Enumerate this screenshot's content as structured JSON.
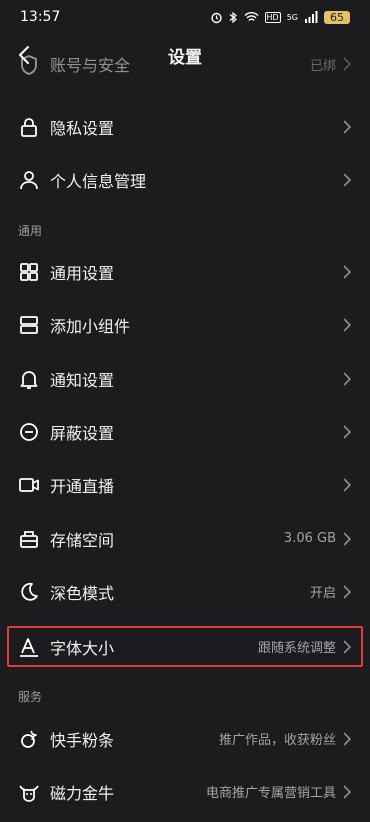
{
  "status": {
    "time": "13:57",
    "battery": "65",
    "network": "5G"
  },
  "nav": {
    "title": "设置"
  },
  "rows": [
    {
      "label": "账号与安全",
      "value": "已绑",
      "icon": "shield-icon"
    },
    {
      "label": "隐私设置",
      "value": "",
      "icon": "lock-icon"
    },
    {
      "label": "个人信息管理",
      "value": "",
      "icon": "person-icon"
    },
    {
      "label": "通用设置",
      "value": "",
      "icon": "grid-icon"
    },
    {
      "label": "添加小组件",
      "value": "",
      "icon": "widget-icon"
    },
    {
      "label": "通知设置",
      "value": "",
      "icon": "bell-icon"
    },
    {
      "label": "屏蔽设置",
      "value": "",
      "icon": "block-icon"
    },
    {
      "label": "开通直播",
      "value": "",
      "icon": "video-icon"
    },
    {
      "label": "存储空间",
      "value": "3.06 GB",
      "icon": "storage-icon"
    },
    {
      "label": "深色模式",
      "value": "开启",
      "icon": "moon-icon"
    },
    {
      "label": "字体大小",
      "value": "跟随系统调整",
      "icon": "font-size-icon"
    },
    {
      "label": "快手粉条",
      "value": "推广作品，收获粉丝",
      "icon": "fan-icon"
    },
    {
      "label": "磁力金牛",
      "value": "电商推广专属营销工具",
      "icon": "bull-icon"
    }
  ],
  "sections": {
    "general": "通用",
    "services": "服务"
  }
}
